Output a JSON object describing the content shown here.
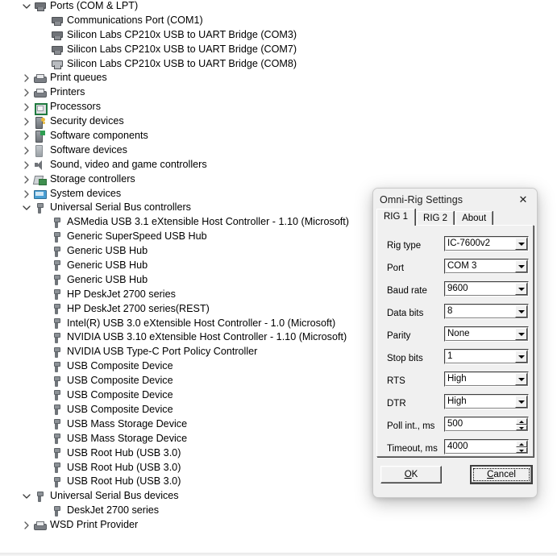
{
  "device_tree": {
    "rows": [
      {
        "label": "Ports (COM & LPT)",
        "indent": 0,
        "chevron": "down",
        "icon": "port-icon"
      },
      {
        "label": "Communications Port (COM1)",
        "indent": 1,
        "chevron": "none",
        "icon": "port-icon"
      },
      {
        "label": "Silicon Labs CP210x USB to UART Bridge (COM3)",
        "indent": 1,
        "chevron": "none",
        "icon": "port-icon"
      },
      {
        "label": "Silicon Labs CP210x USB to UART Bridge (COM7)",
        "indent": 1,
        "chevron": "none",
        "icon": "port-icon"
      },
      {
        "label": "Silicon Labs CP210x USB to UART Bridge (COM8)",
        "indent": 1,
        "chevron": "none",
        "icon": "port-disconnected-icon"
      },
      {
        "label": "Print queues",
        "indent": 0,
        "chevron": "right",
        "icon": "printer-icon"
      },
      {
        "label": "Printers",
        "indent": 0,
        "chevron": "right",
        "icon": "printer-icon"
      },
      {
        "label": "Processors",
        "indent": 0,
        "chevron": "right",
        "icon": "processor-icon"
      },
      {
        "label": "Security devices",
        "indent": 0,
        "chevron": "right",
        "icon": "security-device-icon"
      },
      {
        "label": "Software components",
        "indent": 0,
        "chevron": "right",
        "icon": "software-component-icon"
      },
      {
        "label": "Software devices",
        "indent": 0,
        "chevron": "right",
        "icon": "software-device-icon"
      },
      {
        "label": "Sound, video and game controllers",
        "indent": 0,
        "chevron": "right",
        "icon": "speaker-icon"
      },
      {
        "label": "Storage controllers",
        "indent": 0,
        "chevron": "right",
        "icon": "storage-controller-icon"
      },
      {
        "label": "System devices",
        "indent": 0,
        "chevron": "right",
        "icon": "system-device-icon"
      },
      {
        "label": "Universal Serial Bus controllers",
        "indent": 0,
        "chevron": "down",
        "icon": "usb-icon"
      },
      {
        "label": "ASMedia USB 3.1 eXtensible Host Controller - 1.10 (Microsoft)",
        "indent": 1,
        "chevron": "none",
        "icon": "usb-icon"
      },
      {
        "label": "Generic SuperSpeed USB Hub",
        "indent": 1,
        "chevron": "none",
        "icon": "usb-icon"
      },
      {
        "label": "Generic USB Hub",
        "indent": 1,
        "chevron": "none",
        "icon": "usb-icon"
      },
      {
        "label": "Generic USB Hub",
        "indent": 1,
        "chevron": "none",
        "icon": "usb-icon"
      },
      {
        "label": "Generic USB Hub",
        "indent": 1,
        "chevron": "none",
        "icon": "usb-icon"
      },
      {
        "label": "HP DeskJet 2700 series",
        "indent": 1,
        "chevron": "none",
        "icon": "usb-icon"
      },
      {
        "label": "HP DeskJet 2700 series(REST)",
        "indent": 1,
        "chevron": "none",
        "icon": "usb-icon"
      },
      {
        "label": "Intel(R) USB 3.0 eXtensible Host Controller - 1.0 (Microsoft)",
        "indent": 1,
        "chevron": "none",
        "icon": "usb-icon"
      },
      {
        "label": "NVIDIA USB 3.10 eXtensible Host Controller - 1.10 (Microsoft)",
        "indent": 1,
        "chevron": "none",
        "icon": "usb-icon"
      },
      {
        "label": "NVIDIA USB Type-C Port Policy Controller",
        "indent": 1,
        "chevron": "none",
        "icon": "usb-icon"
      },
      {
        "label": "USB Composite Device",
        "indent": 1,
        "chevron": "none",
        "icon": "usb-icon"
      },
      {
        "label": "USB Composite Device",
        "indent": 1,
        "chevron": "none",
        "icon": "usb-icon"
      },
      {
        "label": "USB Composite Device",
        "indent": 1,
        "chevron": "none",
        "icon": "usb-icon"
      },
      {
        "label": "USB Composite Device",
        "indent": 1,
        "chevron": "none",
        "icon": "usb-icon"
      },
      {
        "label": "USB Mass Storage Device",
        "indent": 1,
        "chevron": "none",
        "icon": "usb-icon"
      },
      {
        "label": "USB Mass Storage Device",
        "indent": 1,
        "chevron": "none",
        "icon": "usb-icon"
      },
      {
        "label": "USB Root Hub (USB 3.0)",
        "indent": 1,
        "chevron": "none",
        "icon": "usb-icon"
      },
      {
        "label": "USB Root Hub (USB 3.0)",
        "indent": 1,
        "chevron": "none",
        "icon": "usb-icon"
      },
      {
        "label": "USB Root Hub (USB 3.0)",
        "indent": 1,
        "chevron": "none",
        "icon": "usb-icon"
      },
      {
        "label": "Universal Serial Bus devices",
        "indent": 0,
        "chevron": "down",
        "icon": "usb-icon"
      },
      {
        "label": "DeskJet 2700 series",
        "indent": 1,
        "chevron": "none",
        "icon": "usb-icon"
      },
      {
        "label": "WSD Print Provider",
        "indent": 0,
        "chevron": "right",
        "icon": "printer-icon"
      }
    ]
  },
  "dialog": {
    "title": "Omni-Rig Settings",
    "close_label": "✕",
    "tabs": [
      {
        "label": "RIG 1",
        "active": true
      },
      {
        "label": "RIG 2",
        "active": false
      },
      {
        "label": "About",
        "active": false
      }
    ],
    "fields": [
      {
        "label": "Rig type",
        "value": "IC-7600v2",
        "control": "dropdown"
      },
      {
        "label": "Port",
        "value": "COM 3",
        "control": "dropdown"
      },
      {
        "label": "Baud rate",
        "value": "9600",
        "control": "dropdown"
      },
      {
        "label": "Data bits",
        "value": "8",
        "control": "dropdown"
      },
      {
        "label": "Parity",
        "value": "None",
        "control": "dropdown"
      },
      {
        "label": "Stop bits",
        "value": "1",
        "control": "dropdown"
      },
      {
        "label": "RTS",
        "value": "High",
        "control": "dropdown"
      },
      {
        "label": "DTR",
        "value": "High",
        "control": "dropdown"
      },
      {
        "label": "Poll int., ms",
        "value": "500",
        "control": "spinner"
      },
      {
        "label": "Timeout, ms",
        "value": "4000",
        "control": "spinner"
      }
    ],
    "buttons": {
      "ok": {
        "prefix": "",
        "accel": "O",
        "suffix": "K"
      },
      "cancel": {
        "prefix": "",
        "accel": "C",
        "suffix": "ancel"
      }
    }
  },
  "colors": {
    "dialog_face": "#f0f0f0",
    "window_bg": "#ffffff",
    "text": "#000000",
    "usb_icon": "#6f7479",
    "accent_green": "#2f9e52"
  }
}
